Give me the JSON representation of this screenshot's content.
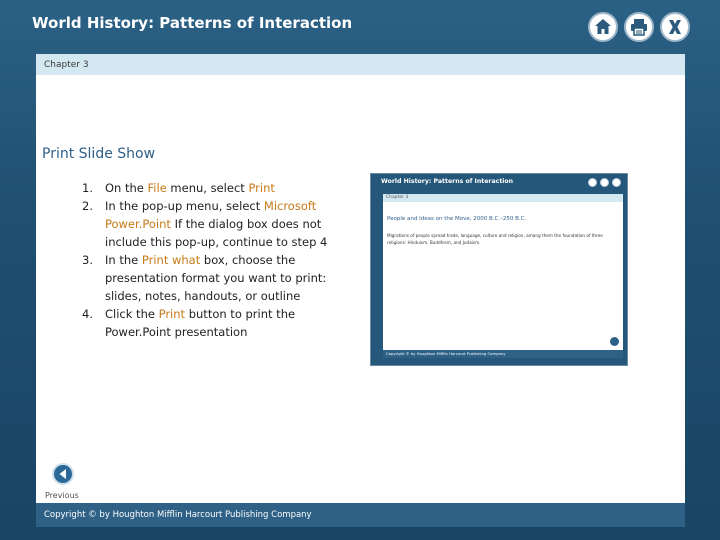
{
  "header": {
    "title": "World History: Patterns of Interaction",
    "icons": [
      "home-icon",
      "print-icon",
      "close-icon"
    ]
  },
  "chapter_label": "Chapter 3",
  "slide": {
    "title": "Print Slide Show",
    "steps": [
      {
        "number": "1.",
        "parts": [
          {
            "text": "On the ",
            "hl": false
          },
          {
            "text": "File",
            "hl": true
          },
          {
            "text": " menu, select ",
            "hl": false
          },
          {
            "text": "Print",
            "hl": true
          }
        ]
      },
      {
        "number": "2.",
        "parts": [
          {
            "text": "In the pop-up menu, select ",
            "hl": false
          },
          {
            "text": "Microsoft Power.Point",
            "hl": true
          },
          {
            "text": " If the dialog box does not include this pop-up, continue to step 4",
            "hl": false
          }
        ]
      },
      {
        "number": "3.",
        "parts": [
          {
            "text": "In the ",
            "hl": false
          },
          {
            "text": "Print what",
            "hl": true
          },
          {
            "text": " box, choose the presentation format you want to print: slides, notes, handouts, or outline",
            "hl": false
          }
        ]
      },
      {
        "number": "4.",
        "parts": [
          {
            "text": "Click the ",
            "hl": false
          },
          {
            "text": "Print",
            "hl": true
          },
          {
            "text": " button to print the Power.Point presentation",
            "hl": false
          }
        ]
      }
    ]
  },
  "thumbnail": {
    "title": "World History: Patterns of Interaction",
    "chapter": "Chapter 3",
    "heading": "People and Ideas on the Move, 2000 B.C.–250 B.C.",
    "body": "Migrations of people spread trade, language, culture and religion, among them the foundation of three religions: Hinduism, Buddhism, and Judaism.",
    "footer": "Copyright © by Houghton Mifflin Harcourt Publishing Company"
  },
  "nav": {
    "previous_label": "Previous"
  },
  "footer": {
    "copyright": "Copyright © by Houghton Mifflin Harcourt Publishing Company"
  },
  "colors": {
    "frame": "#1f4f71",
    "chapter_bar": "#d4e8f1",
    "highlight": "#c77a17",
    "title_blue": "#2f5f89"
  }
}
